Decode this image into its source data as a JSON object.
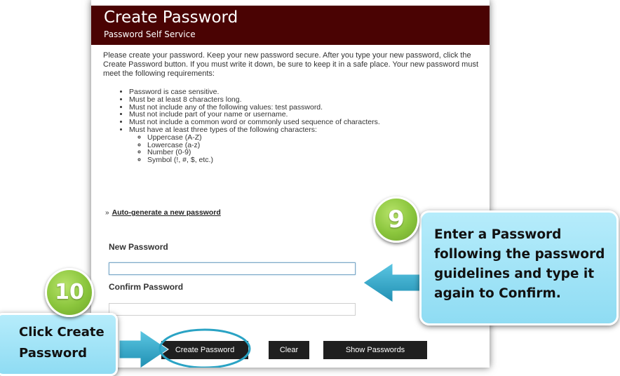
{
  "header": {
    "title": "Create Password",
    "subtitle": "Password Self Service"
  },
  "intro_text": "Please create your password. Keep your new password secure. After you type your new password, click the Create Password button. If you must write it down, be sure to keep it in a safe place. Your new password must meet the following requirements:",
  "requirements": [
    "Password is case sensitive.",
    "Must be at least 8 characters long.",
    "Must not include any of the following values: test password.",
    "Must not include part of your name or username.",
    "Must not include a common word or commonly used sequence of characters.",
    "Must have at least three types of the following characters:"
  ],
  "char_types": [
    "Uppercase (A-Z)",
    "Lowercase (a-z)",
    "Number (0-9)",
    "Symbol (!, #, $, etc.)"
  ],
  "autogen": {
    "chevron": "»",
    "link": "Auto-generate a new password"
  },
  "form": {
    "new_password_label": "New Password",
    "new_password_value": "",
    "confirm_password_label": "Confirm Password",
    "confirm_password_value": ""
  },
  "buttons": {
    "create": "Create Password",
    "clear": "Clear",
    "show": "Show Passwords"
  },
  "callouts": {
    "step9_number": "9",
    "step9_text": "Enter a Password following the password guidelines and type it again to Confirm.",
    "step10_number": "10",
    "step10_text": "Click Create Password"
  },
  "colors": {
    "header_bg": "#4a0303",
    "badge_green": "#8ac53c",
    "callout_blue": "#8fdcf3",
    "arrow_teal": "#2aa3c4"
  }
}
